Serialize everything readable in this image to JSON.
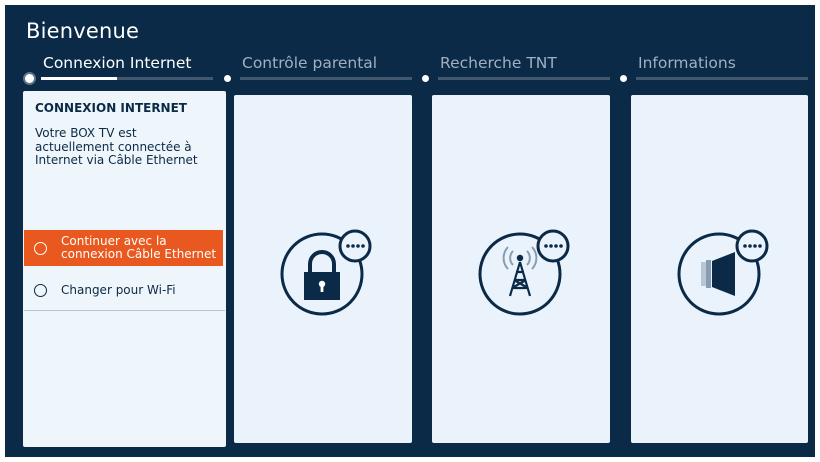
{
  "header": {
    "title": "Bienvenue"
  },
  "steps": [
    {
      "label": "Connexion Internet",
      "active": true,
      "progress": 0.44
    },
    {
      "label": "Contrôle parental",
      "active": false
    },
    {
      "label": "Recherche TNT",
      "active": false
    },
    {
      "label": "Informations",
      "active": false
    }
  ],
  "internet_card": {
    "heading": "CONNEXION INTERNET",
    "description": "Votre BOX TV est actuellement connectée à Internet via Câble Ethernet",
    "options": [
      {
        "label": "Continuer avec la connexion Câble Ethernet",
        "selected": true
      },
      {
        "label": "Changer pour Wi-Fi",
        "selected": false
      }
    ]
  },
  "cards": [
    {
      "icon": "padlock-icon"
    },
    {
      "icon": "antenna-tower-icon"
    },
    {
      "icon": "info-speaker-icon"
    }
  ],
  "colors": {
    "background": "#0b2a47",
    "card": "#eaf3fb",
    "accent": "#e9581f",
    "text_dark": "#0b2a47"
  }
}
